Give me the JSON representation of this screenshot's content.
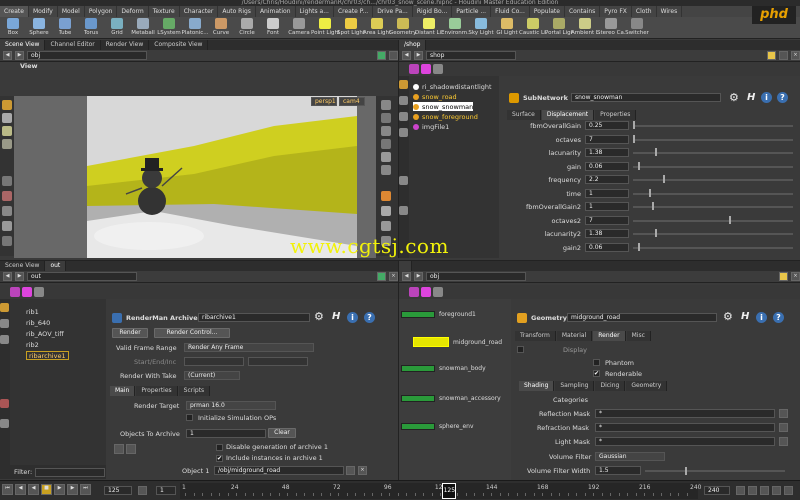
{
  "window": {
    "title": "/Users/Chris/Houdini/rendermanR/chr03/ch.../chr03_snow_scene.hipnc - Houdini Master Education Edition"
  },
  "shelf": {
    "tabs": [
      "Create",
      "Modify",
      "Model",
      "Polygon",
      "Deform",
      "Texture",
      "Character",
      "Auto Rigs",
      "Animation",
      "Lights a...",
      "Create P...",
      "Drive Pa...",
      "Rigid Bo...",
      "Particle ...",
      "Fluid Co...",
      "Populate",
      "Contains",
      "Pyro FX",
      "Cloth",
      "Wires"
    ],
    "tools": [
      {
        "label": "Box",
        "icon": "box-icon",
        "color": "#7aa7d8"
      },
      {
        "label": "Sphere",
        "icon": "sphere-icon",
        "color": "#8ab4e0"
      },
      {
        "label": "Tube",
        "icon": "tube-icon",
        "color": "#7aa0d0"
      },
      {
        "label": "Torus",
        "icon": "torus-icon",
        "color": "#6a98cc"
      },
      {
        "label": "Grid",
        "icon": "grid-icon",
        "color": "#7ab0c0"
      },
      {
        "label": "Metaball",
        "icon": "metaball-icon",
        "color": "#9ab"
      },
      {
        "label": "LSystem",
        "icon": "lsystem-icon",
        "color": "#6a6"
      },
      {
        "label": "Platonic...",
        "icon": "platonic-icon",
        "color": "#8ac"
      },
      {
        "label": "Curve",
        "icon": "curve-icon",
        "color": "#c96"
      },
      {
        "label": "Circle",
        "icon": "circle-icon",
        "color": "#aaa"
      },
      {
        "label": "Font",
        "icon": "font-icon",
        "color": "#ccc"
      },
      {
        "label": "Camera",
        "icon": "camera-icon",
        "color": "#999"
      },
      {
        "label": "Point Light",
        "icon": "point-light-icon",
        "color": "#ee4"
      },
      {
        "label": "Spot Light",
        "icon": "spot-light-icon",
        "color": "#ec4"
      },
      {
        "label": "Area Light",
        "icon": "area-light-icon",
        "color": "#dc5"
      },
      {
        "label": "Geometry...",
        "icon": "geometry-light-icon",
        "color": "#cb5"
      },
      {
        "label": "Distant Li...",
        "icon": "distant-light-icon",
        "color": "#ee6"
      },
      {
        "label": "Environm...",
        "icon": "environment-light-icon",
        "color": "#9c9"
      },
      {
        "label": "Sky Light",
        "icon": "sky-light-icon",
        "color": "#8bd"
      },
      {
        "label": "GI Light",
        "icon": "gi-light-icon",
        "color": "#db6"
      },
      {
        "label": "Caustic Li...",
        "icon": "caustic-light-icon",
        "color": "#cc6"
      },
      {
        "label": "Portal Light",
        "icon": "portal-light-icon",
        "color": "#aa6"
      },
      {
        "label": "Ambient L...",
        "icon": "ambient-light-icon",
        "color": "#cc8"
      },
      {
        "label": "Stereo Ca...",
        "icon": "stereo-camera-icon",
        "color": "#999"
      },
      {
        "label": "Switcher",
        "icon": "switcher-icon",
        "color": "#888"
      }
    ],
    "logo": "phd"
  },
  "viewport": {
    "tabs": [
      "Scene View",
      "Channel Editor",
      "Render View",
      "Composite View"
    ],
    "path": "obj",
    "title": "View",
    "camera_menu": "persp1",
    "cam_menu": "cam4"
  },
  "shop_panel": {
    "tab": "/shop",
    "path": "shop",
    "tree": [
      "ri_shadowdistantlight",
      "snow_road",
      "snow_snowman",
      "snow_foreground",
      "imgFile1"
    ],
    "node_type": "SubNetwork",
    "node_name": "snow_snowman",
    "param_tabs": [
      "Surface",
      "Displacement",
      "Properties"
    ],
    "params": [
      {
        "label": "fbmOverallGain",
        "value": "0.25",
        "level": 0.0
      },
      {
        "label": "octaves",
        "value": "7",
        "level": 0.0
      },
      {
        "label": "lacunarity",
        "value": "1.38",
        "level": 0.14
      },
      {
        "label": "gain",
        "value": "0.06",
        "level": 0.03
      },
      {
        "label": "frequency",
        "value": "2.2",
        "level": 0.19
      },
      {
        "label": "time",
        "value": "1",
        "level": 0.1
      },
      {
        "label": "fbmOverallGain2",
        "value": "1",
        "level": 0.12
      },
      {
        "label": "octaves2",
        "value": "7",
        "level": 0.6
      },
      {
        "label": "lacunarity2",
        "value": "1.38",
        "level": 0.14
      },
      {
        "label": "gain2",
        "value": "0.06",
        "level": 0.03
      }
    ]
  },
  "watermark": "www.cgtsj.com",
  "out_panel": {
    "tabs": [
      "Scene View",
      "out"
    ],
    "path": "out",
    "tree": [
      "rib1",
      "rib_640",
      "rib_AOV_tiff",
      "rib2",
      "ribarchive1"
    ],
    "filter_label": "Filter:",
    "node_type": "RenderMan Archive",
    "node_name": "ribarchive1",
    "render_label": "Render",
    "render_control_label": "Render Control...",
    "valid_frame_range_label": "Valid Frame Range",
    "valid_frame_range_value": "Render Any Frame",
    "start_end_label": "Start/End/Inc",
    "render_with_take_label": "Render With Take",
    "render_with_take_value": "(Current)",
    "tabs2": [
      "Main",
      "Properties",
      "Scripts"
    ],
    "render_target_label": "Render Target",
    "render_target_value": "prman 16.0",
    "init_sim_label": "Initialize Simulation OPs",
    "objects_to_archive_label": "Objects To Archive",
    "objects_to_archive_value": "1",
    "clear_label": "Clear",
    "disable_gen_label": "Disable generation of archive 1",
    "include_instances_label": "Include instances in archive 1",
    "object1_label": "Object 1",
    "object1_value": "/obj/midground_road"
  },
  "obj_panel": {
    "path": "obj",
    "nodes": [
      {
        "name": "foreground1",
        "color": "#2a9a3a"
      },
      {
        "name": "midground_road",
        "color": "#e6e600"
      },
      {
        "name": "snowman_body",
        "color": "#2a9a3a"
      },
      {
        "name": "snowman_accessory",
        "color": "#2a9a3a"
      },
      {
        "name": "sphere_env",
        "color": "#2a9a3a"
      }
    ],
    "node_type": "Geometry",
    "node_name": "midground_road",
    "tabs": [
      "Transform",
      "Material",
      "Render",
      "Misc"
    ],
    "display_label": "Display",
    "phantom_label": "Phantom",
    "renderable_label": "Renderable",
    "tabs2": [
      "Shading",
      "Sampling",
      "Dicing",
      "Geometry"
    ],
    "categories_label": "Categories",
    "reflection_mask_label": "Reflection Mask",
    "refraction_mask_label": "Refraction Mask",
    "light_mask_label": "Light Mask",
    "mask_value": "*",
    "volume_filter_label": "Volume Filter",
    "volume_filter_value": "Gaussian",
    "volume_filter_width_label": "Volume Filter Width",
    "volume_filter_width_value": "1.5"
  },
  "timeline": {
    "frame": "125",
    "start": "1",
    "end": "240",
    "ticks": [
      "1",
      "24",
      "48",
      "72",
      "96",
      "120",
      "144",
      "168",
      "192",
      "216",
      "240"
    ],
    "current_marker": "125"
  },
  "colors": {
    "accent": "#e6e600",
    "selected_node_text": "#ffcc33"
  }
}
